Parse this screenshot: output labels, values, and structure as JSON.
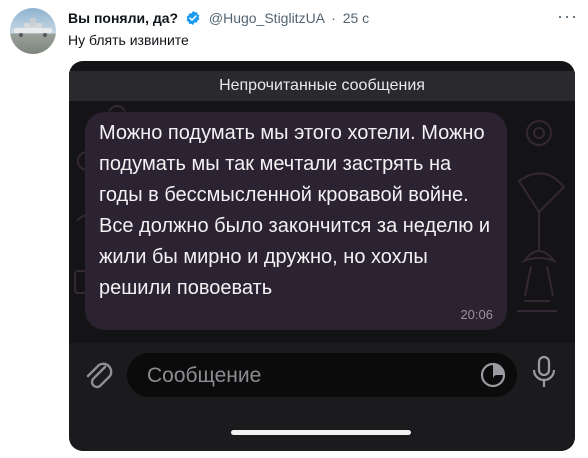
{
  "tweet": {
    "display_name": "Вы поняли, да?",
    "handle": "@Hugo_StiglitzUA",
    "separator": "·",
    "time": "25 с",
    "text": "Ну блять извините",
    "verified_color": "#1d9bf0"
  },
  "screenshot": {
    "unread_label": "Непрочитанные сообщения",
    "message": {
      "text": "Можно подумать мы этого хотели. Можно подумать мы так мечтали застрять на годы в бессмысленной кровавой войне. Все должно было закончится за неделю и жили бы мирно и дружно, но хохлы решили повоевать",
      "time": "20:06"
    },
    "composer": {
      "placeholder": "Сообщение"
    },
    "icons": [
      "paperclip-icon",
      "sticker-icon",
      "microphone-icon"
    ]
  }
}
